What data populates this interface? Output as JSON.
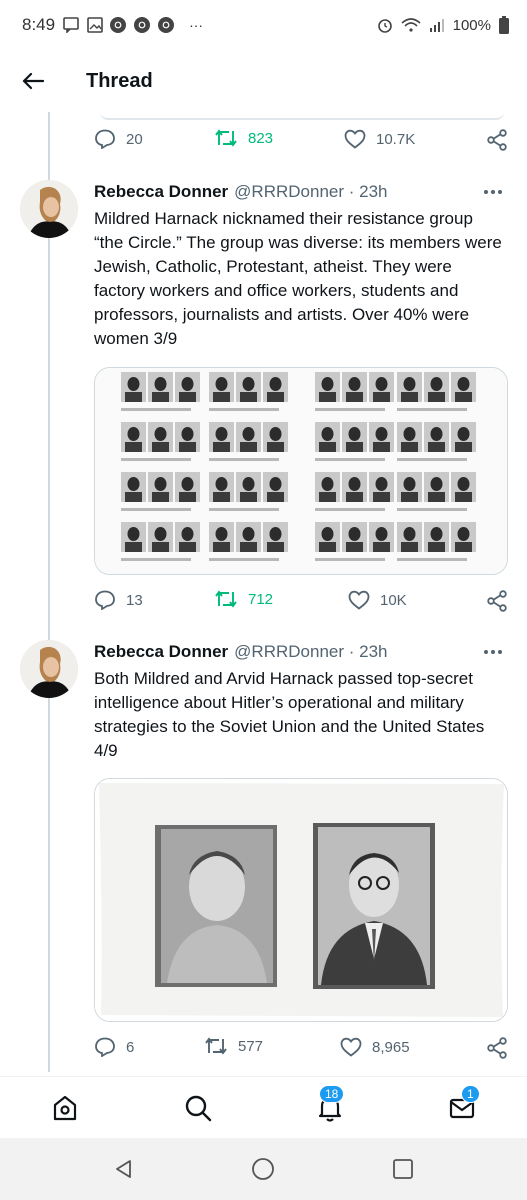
{
  "status_bar": {
    "time": "8:49",
    "battery": "100%",
    "dots": "···"
  },
  "header": {
    "title": "Thread"
  },
  "top_actions": {
    "replies": "20",
    "retweets": "823",
    "likes": "10.7K"
  },
  "tweets": [
    {
      "name": "Rebecca Donner",
      "handle": "@RRRDonner · 23h",
      "text": "Mildred Harnack nicknamed their resistance group “the Circle.” The group was diverse: its members were Jewish, Catholic, Protestant, atheist. They were factory workers and office workers, students and professors, journalists and artists. Over 40% were women  3/9",
      "replies": "13",
      "retweets": "712",
      "likes": "10K"
    },
    {
      "name": "Rebecca Donner",
      "handle": "@RRRDonner · 23h",
      "text": "Both Mildred and Arvid Harnack passed top-secret intelligence about Hitler’s operational and military strategies to the Soviet Union and the United States  4/9",
      "replies": "6",
      "retweets": "577",
      "likes": "8,965"
    }
  ],
  "bottom_nav": {
    "notifications_badge": "18",
    "messages_badge": "1"
  },
  "colors": {
    "accent": "#1d9bf0",
    "retweet_green": "#00ba7c",
    "muted": "#536471"
  }
}
